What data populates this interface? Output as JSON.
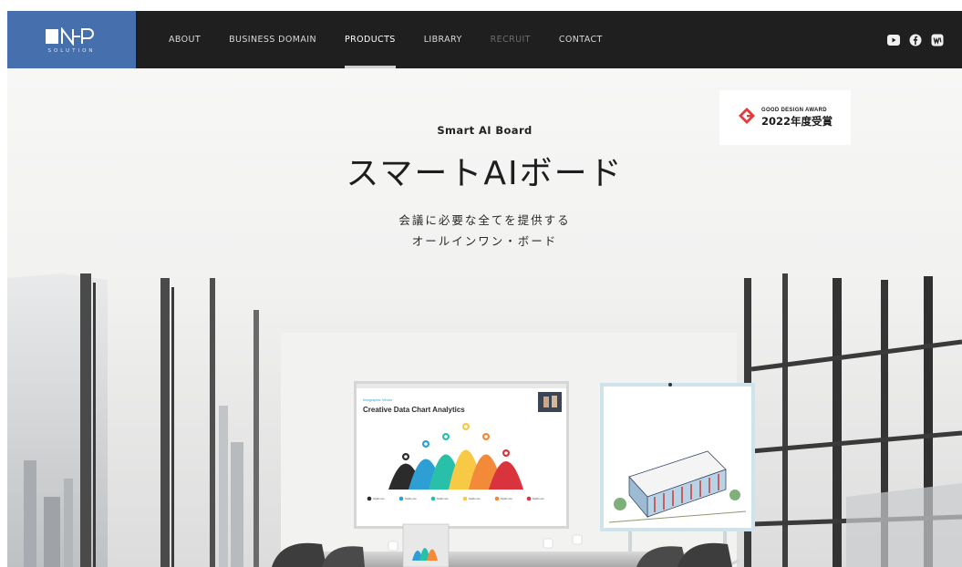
{
  "brand": {
    "logo_text": "N-P",
    "logo_sub": "SOLUTION"
  },
  "nav": {
    "items": [
      {
        "label": "ABOUT",
        "state": "normal"
      },
      {
        "label": "BUSINESS DOMAIN",
        "state": "normal"
      },
      {
        "label": "PRODUCTS",
        "state": "active"
      },
      {
        "label": "LIBRARY",
        "state": "normal"
      },
      {
        "label": "RECRUIT",
        "state": "disabled"
      },
      {
        "label": "CONTACT",
        "state": "normal"
      }
    ],
    "social": [
      "youtube-icon",
      "facebook-icon",
      "wordpress-icon"
    ]
  },
  "award": {
    "top": "GOOD DESIGN AWARD",
    "year": "2022年度受賞"
  },
  "hero": {
    "eyebrow": "Smart AI Board",
    "title": "スマートAIボード",
    "desc_line1": "会議に必要な全てを提供する",
    "desc_line2": "オールインワン・ボード"
  },
  "screen": {
    "label": "Infographic Vector",
    "title": "Creative Data Chart Analytics",
    "legend": [
      "Stylize one",
      "Stylize one",
      "Stylize one",
      "Stylize one",
      "Stylize one",
      "Stylize one"
    ]
  },
  "colors": {
    "nav_bg": "#1f1f1f",
    "logo_bg": "#4670ad",
    "award_red": "#e03c3c",
    "chart_series": [
      "#2b2b2b",
      "#2d9fd4",
      "#28c0a8",
      "#f7c945",
      "#f28a3a",
      "#d9343e"
    ]
  }
}
